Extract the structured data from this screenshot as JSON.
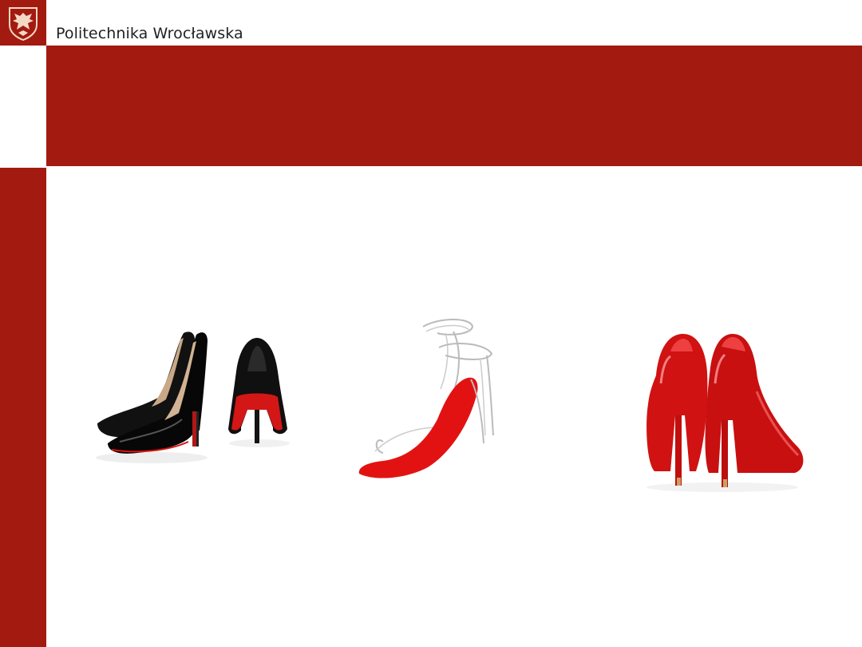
{
  "header": {
    "university_name": "Politechnika Wrocławska",
    "logo_icon": "eagle-shield-icon"
  },
  "colors": {
    "brand_red": "#a31a10",
    "sole_red": "#e01414",
    "patent_black": "#121212"
  },
  "slide": {
    "title": "",
    "images": [
      {
        "name": "black-pumps-image",
        "description_icon": "black-patent-heels-icon"
      },
      {
        "name": "sandal-sketch-image",
        "description_icon": "red-sole-sandal-sketch-icon"
      },
      {
        "name": "red-pumps-image",
        "description_icon": "red-patent-heels-icon"
      }
    ]
  }
}
